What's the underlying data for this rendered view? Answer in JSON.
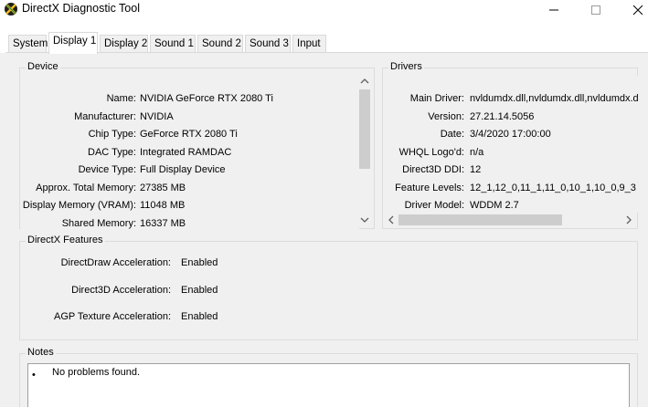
{
  "window": {
    "title": "DirectX Diagnostic Tool"
  },
  "tabs": [
    {
      "label": "System"
    },
    {
      "label": "Display 1"
    },
    {
      "label": "Display 2"
    },
    {
      "label": "Sound 1"
    },
    {
      "label": "Sound 2"
    },
    {
      "label": "Sound 3"
    },
    {
      "label": "Input"
    }
  ],
  "device": {
    "title": "Device",
    "fields": [
      {
        "label": "Name:",
        "value": "NVIDIA GeForce RTX 2080 Ti"
      },
      {
        "label": "Manufacturer:",
        "value": "NVIDIA"
      },
      {
        "label": "Chip Type:",
        "value": "GeForce RTX 2080 Ti"
      },
      {
        "label": "DAC Type:",
        "value": "Integrated RAMDAC"
      },
      {
        "label": "Device Type:",
        "value": "Full Display Device"
      },
      {
        "label": "Approx. Total Memory:",
        "value": "27385 MB"
      },
      {
        "label": "Display Memory (VRAM):",
        "value": "11048 MB"
      },
      {
        "label": "Shared Memory:",
        "value": "16337 MB"
      }
    ]
  },
  "drivers": {
    "title": "Drivers",
    "fields": [
      {
        "label": "Main Driver:",
        "value": "nvldumdx.dll,nvldumdx.dll,nvldumdx.dll"
      },
      {
        "label": "Version:",
        "value": "27.21.14.5056"
      },
      {
        "label": "Date:",
        "value": "3/4/2020 17:00:00"
      },
      {
        "label": "WHQL Logo'd:",
        "value": "n/a"
      },
      {
        "label": "Direct3D DDI:",
        "value": "12"
      },
      {
        "label": "Feature Levels:",
        "value": "12_1,12_0,11_1,11_0,10_1,10_0,9_3"
      },
      {
        "label": "Driver Model:",
        "value": "WDDM 2.7"
      }
    ]
  },
  "features": {
    "title": "DirectX Features",
    "fields": [
      {
        "label": "DirectDraw Acceleration:",
        "value": "Enabled"
      },
      {
        "label": "Direct3D Acceleration:",
        "value": "Enabled"
      },
      {
        "label": "AGP Texture Acceleration:",
        "value": "Enabled"
      }
    ]
  },
  "notes": {
    "title": "Notes",
    "items": [
      "No problems found."
    ]
  },
  "colors": {
    "window_bg": "#f0f0f0",
    "scroll_thumb": "#cdcdcd"
  }
}
